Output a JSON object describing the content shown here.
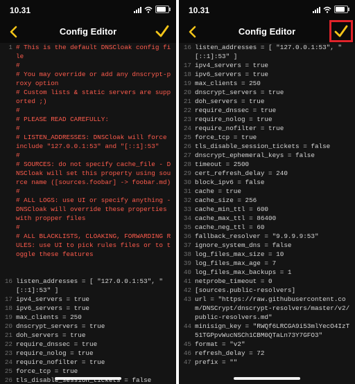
{
  "colors": {
    "accent": "#f5c518",
    "comment": "#ff5c4d",
    "highlight": "#e0232a"
  },
  "left": {
    "status": {
      "time": "10.31"
    },
    "title": "Config Editor",
    "lines": [
      {
        "n": "1",
        "t": "# This is the default DNSCloak config file",
        "c": true
      },
      {
        "n": "",
        "t": "#",
        "c": true
      },
      {
        "n": "",
        "t": "# You may override or add any dnscrypt-proxy option",
        "c": true
      },
      {
        "n": "",
        "t": "# Custom lists & static servers are supported ;)",
        "c": true
      },
      {
        "n": "",
        "t": "#",
        "c": true
      },
      {
        "n": "",
        "t": "# PLEASE READ CAREFULLY:",
        "c": true
      },
      {
        "n": "",
        "t": "#",
        "c": true
      },
      {
        "n": "",
        "t": "# LISTEN_ADDRESSES: DNSCloak will force include \"127.0.0.1:53\" and \"[::1]:53\"",
        "c": true
      },
      {
        "n": "",
        "t": "#",
        "c": true
      },
      {
        "n": "",
        "t": "# SOURCES: do not specify cache_file - DNSCloak will set this property using source name ([sources.foobar] -> foobar.md)",
        "c": true
      },
      {
        "n": "",
        "t": "#",
        "c": true
      },
      {
        "n": "",
        "t": "# ALL LOGS: use UI or specify anything - DNSCloak will override these properties with propper files",
        "c": true
      },
      {
        "n": "",
        "t": "#",
        "c": true
      },
      {
        "n": "",
        "t": "# ALL BLACKLISTS, CLOAKING, FORWARDING RULES: use UI to pick rules files or to toggle these features",
        "c": true
      },
      {
        "n": "",
        "t": "",
        "c": false
      },
      {
        "n": "",
        "t": "",
        "c": false
      },
      {
        "n": "16",
        "t": "listen_addresses = [ \"127.0.0.1:53\", \"[::1]:53\" ]",
        "c": false
      },
      {
        "n": "17",
        "t": "ipv4_servers = true",
        "c": false
      },
      {
        "n": "18",
        "t": "ipv6_servers = true",
        "c": false
      },
      {
        "n": "19",
        "t": "max_clients = 250",
        "c": false
      },
      {
        "n": "20",
        "t": "dnscrypt_servers = true",
        "c": false
      },
      {
        "n": "21",
        "t": "doh_servers = true",
        "c": false
      },
      {
        "n": "22",
        "t": "require_dnssec = true",
        "c": false
      },
      {
        "n": "23",
        "t": "require_nolog = true",
        "c": false
      },
      {
        "n": "24",
        "t": "require_nofilter = true",
        "c": false
      },
      {
        "n": "25",
        "t": "force_tcp = true",
        "c": false
      },
      {
        "n": "26",
        "t": "tls_disable_session_tickets = false",
        "c": false
      }
    ]
  },
  "right": {
    "status": {
      "time": "10.31"
    },
    "title": "Config Editor",
    "lines": [
      {
        "n": "16",
        "t": "listen_addresses = [ \"127.0.0.1:53\", \"[::1]:53\" ]"
      },
      {
        "n": "17",
        "t": "ipv4_servers = true"
      },
      {
        "n": "18",
        "t": "ipv6_servers = true"
      },
      {
        "n": "19",
        "t": "max_clients = 250"
      },
      {
        "n": "20",
        "t": "dnscrypt_servers = true"
      },
      {
        "n": "21",
        "t": "doh_servers = true"
      },
      {
        "n": "22",
        "t": "require_dnssec = true"
      },
      {
        "n": "23",
        "t": "require_nolog = true"
      },
      {
        "n": "24",
        "t": "require_nofilter = true"
      },
      {
        "n": "25",
        "t": "force_tcp = true"
      },
      {
        "n": "26",
        "t": "tls_disable_session_tickets = false"
      },
      {
        "n": "27",
        "t": "dnscrypt_ephemeral_keys = false"
      },
      {
        "n": "28",
        "t": "timeout = 2500"
      },
      {
        "n": "29",
        "t": "cert_refresh_delay = 240"
      },
      {
        "n": "30",
        "t": "block_ipv6 = false"
      },
      {
        "n": "31",
        "t": "cache = true"
      },
      {
        "n": "32",
        "t": "cache_size = 256"
      },
      {
        "n": "33",
        "t": "cache_min_ttl = 600"
      },
      {
        "n": "34",
        "t": "cache_max_ttl = 86400"
      },
      {
        "n": "35",
        "t": "cache_neg_ttl = 60"
      },
      {
        "n": "36",
        "t": "fallback_resolver = \"9.9.9.9:53\""
      },
      {
        "n": "37",
        "t": "ignore_system_dns = false"
      },
      {
        "n": "38",
        "t": "log_files_max_size = 10"
      },
      {
        "n": "39",
        "t": "log_files_max_age = 7"
      },
      {
        "n": "40",
        "t": "log_files_max_backups = 1"
      },
      {
        "n": "41",
        "t": "netprobe_timeout = 0"
      },
      {
        "n": "42",
        "t": "[sources.public-resolvers]"
      },
      {
        "n": "43",
        "t": "url = \"https://raw.githubusercontent.com/DNSCrypt/dnscrypt-resolvers/master/v2/public-resolvers.md\""
      },
      {
        "n": "44",
        "t": "minisign_key = \"RWQf6LRCGA9i53mlYecO4IzT51TGPpvWucNSCh1CBM0QTaLn73Y7GFO3\""
      },
      {
        "n": "45",
        "t": "format = \"v2\""
      },
      {
        "n": "46",
        "t": "refresh_delay = 72"
      },
      {
        "n": "47",
        "t": "prefix = \"\""
      }
    ]
  }
}
